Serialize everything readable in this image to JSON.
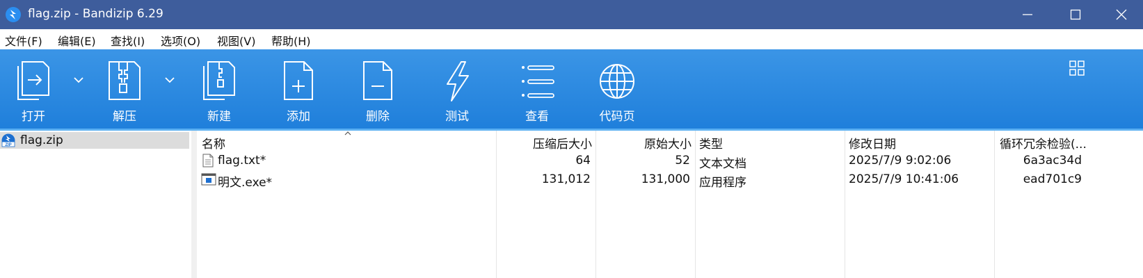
{
  "window": {
    "title": "flag.zip - Bandizip 6.29"
  },
  "menu": [
    {
      "label": "文件(F)"
    },
    {
      "label": "编辑(E)"
    },
    {
      "label": "查找(I)"
    },
    {
      "label": "选项(O)"
    },
    {
      "label": "视图(V)"
    },
    {
      "label": "帮助(H)"
    }
  ],
  "toolbar": {
    "open_label": "打开",
    "extract_label": "解压",
    "new_label": "新建",
    "add_label": "添加",
    "delete_label": "删除",
    "test_label": "测试",
    "view_label": "查看",
    "codepage_label": "代码页"
  },
  "tree": {
    "root_label": "flag.zip"
  },
  "columns": {
    "name": "名称",
    "packed": "压缩后大小",
    "original": "原始大小",
    "type": "类型",
    "modified": "修改日期",
    "crc": "循环冗余检验(..."
  },
  "files": [
    {
      "name": "flag.txt*",
      "packed": "64",
      "original": "52",
      "type": "文本文档",
      "modified": "2025/7/9 9:02:06",
      "crc": "6a3ac34d",
      "icon": "text-file-icon"
    },
    {
      "name": "明文.exe*",
      "packed": "131,012",
      "original": "131,000",
      "type": "应用程序",
      "modified": "2025/7/9 10:41:06",
      "crc": "ead701c9",
      "icon": "exe-file-icon"
    }
  ],
  "colors": {
    "titlebar": "#3e5d9c",
    "toolbar": "#2588e0",
    "selection": "#dcdcdc"
  }
}
